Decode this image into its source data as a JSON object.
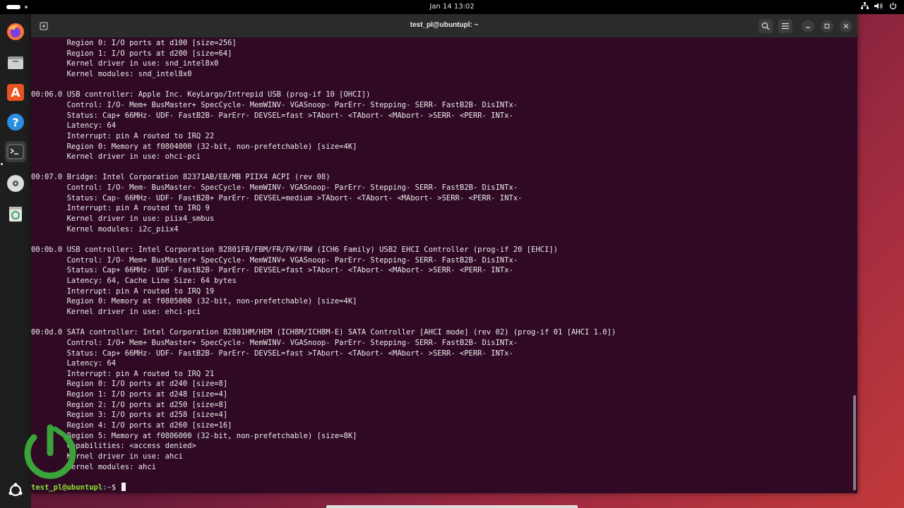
{
  "topbar": {
    "clock": "Jan 14  13:02",
    "icons": [
      "network-icon",
      "volume-icon",
      "power-icon"
    ]
  },
  "dock": {
    "apps": [
      {
        "name": "firefox-icon",
        "color": "#ff7139"
      },
      {
        "name": "files-icon",
        "color": "#c9c9c9"
      },
      {
        "name": "app-center-icon",
        "color": "#e95420"
      },
      {
        "name": "help-icon",
        "color": "#2c8ee0"
      },
      {
        "name": "terminal-icon",
        "color": "#2e2e2e"
      },
      {
        "name": "disc-icon",
        "color": "#dcdcdc"
      },
      {
        "name": "trash-icon",
        "color": "#3ba55c"
      }
    ],
    "show_apps_icon": "ubuntu-logo-icon"
  },
  "window": {
    "title": "test_pl@ubuntupl: ~"
  },
  "terminal": {
    "lines": [
      "        Region 0: I/O ports at d100 [size=256]",
      "        Region 1: I/O ports at d200 [size=64]",
      "        Kernel driver in use: snd_intel8x0",
      "        Kernel modules: snd_intel8x0",
      "",
      "00:06.0 USB controller: Apple Inc. KeyLargo/Intrepid USB (prog-if 10 [OHCI])",
      "        Control: I/O- Mem+ BusMaster+ SpecCycle- MemWINV- VGASnoop- ParErr- Stepping- SERR- FastB2B- DisINTx-",
      "        Status: Cap+ 66MHz- UDF- FastB2B- ParErr- DEVSEL=fast >TAbort- <TAbort- <MAbort- >SERR- <PERR- INTx-",
      "        Latency: 64",
      "        Interrupt: pin A routed to IRQ 22",
      "        Region 0: Memory at f0804000 (32-bit, non-prefetchable) [size=4K]",
      "        Kernel driver in use: ohci-pci",
      "",
      "00:07.0 Bridge: Intel Corporation 82371AB/EB/MB PIIX4 ACPI (rev 08)",
      "        Control: I/O- Mem- BusMaster- SpecCycle- MemWINV- VGASnoop- ParErr- Stepping- SERR- FastB2B- DisINTx-",
      "        Status: Cap- 66MHz- UDF- FastB2B+ ParErr- DEVSEL=medium >TAbort- <TAbort- <MAbort- >SERR- <PERR- INTx-",
      "        Interrupt: pin A routed to IRQ 9",
      "        Kernel driver in use: piix4_smbus",
      "        Kernel modules: i2c_piix4",
      "",
      "00:0b.0 USB controller: Intel Corporation 82801FB/FBM/FR/FW/FRW (ICH6 Family) USB2 EHCI Controller (prog-if 20 [EHCI])",
      "        Control: I/O- Mem+ BusMaster+ SpecCycle- MemWINV+ VGASnoop- ParErr- Stepping- SERR- FastB2B- DisINTx-",
      "        Status: Cap+ 66MHz- UDF- FastB2B- ParErr- DEVSEL=fast >TAbort- <TAbort- <MAbort- >SERR- <PERR- INTx-",
      "        Latency: 64, Cache Line Size: 64 bytes",
      "        Interrupt: pin A routed to IRQ 19",
      "        Region 0: Memory at f0805000 (32-bit, non-prefetchable) [size=4K]",
      "        Kernel driver in use: ehci-pci",
      "",
      "00:0d.0 SATA controller: Intel Corporation 82801HM/HEM (ICH8M/ICH8M-E) SATA Controller [AHCI mode] (rev 02) (prog-if 01 [AHCI 1.0])",
      "        Control: I/O+ Mem+ BusMaster+ SpecCycle- MemWINV- VGASnoop- ParErr- Stepping- SERR- FastB2B- DisINTx-",
      "        Status: Cap+ 66MHz- UDF- FastB2B- ParErr- DEVSEL=fast >TAbort- <TAbort- <MAbort- >SERR- <PERR- INTx-",
      "        Latency: 64",
      "        Interrupt: pin A routed to IRQ 21",
      "        Region 0: I/O ports at d240 [size=8]",
      "        Region 1: I/O ports at d248 [size=4]",
      "        Region 2: I/O ports at d250 [size=8]",
      "        Region 3: I/O ports at d258 [size=4]",
      "        Region 4: I/O ports at d260 [size=16]",
      "        Region 5: Memory at f0806000 (32-bit, non-prefetchable) [size=8K]",
      "        Capabilities: <access denied>",
      "        Kernel driver in use: ahci",
      "        Kernel modules: ahci"
    ],
    "prompt": {
      "user_host": "test_pl@ubuntupl",
      "path": ":~",
      "symbol": "$ "
    }
  }
}
